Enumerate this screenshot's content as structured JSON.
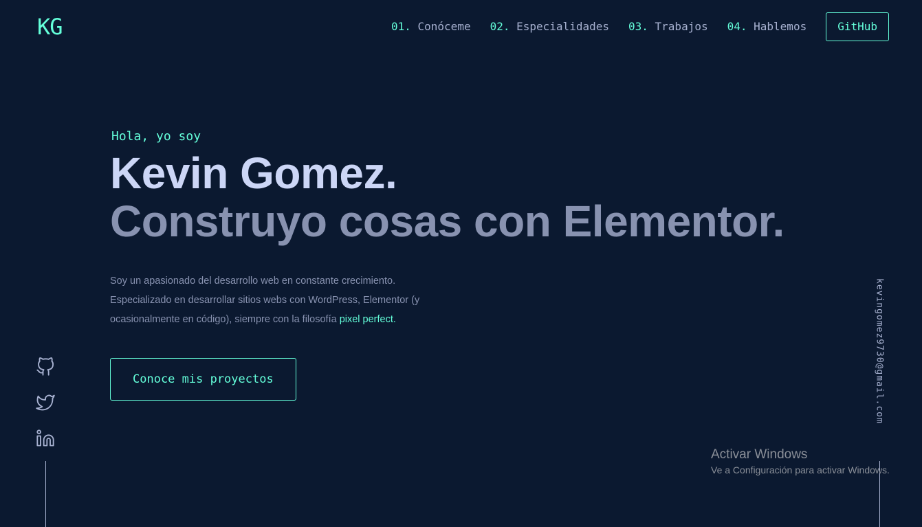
{
  "header": {
    "logo": "KG",
    "nav": [
      {
        "num": "01.",
        "label": "Conóceme"
      },
      {
        "num": "02.",
        "label": "Especialidades"
      },
      {
        "num": "03.",
        "label": "Trabajos"
      },
      {
        "num": "04.",
        "label": "Hablemos"
      }
    ],
    "github_label": "GitHub"
  },
  "hero": {
    "intro": "Hola, yo soy",
    "name": "Kevin Gomez.",
    "tagline": "Construyo cosas con Elementor.",
    "bio_line1": "Soy un apasionado del desarrollo web en constante crecimiento.",
    "bio_line2": "Especializado en desarrollar sitios webs con WordPress, Elementor (y",
    "bio_line3": "ocasionalmente en código), siempre con la filosofía",
    "bio_accent": "pixel perfect.",
    "cta_label": "Conoce mis proyectos"
  },
  "social": {
    "icons": [
      "github-icon",
      "twitter-icon",
      "linkedin-icon"
    ]
  },
  "email": "kevingomez9730@gmail.com",
  "windows_watermark": {
    "title": "Activar Windows",
    "subtitle": "Ve a Configuración para activar Windows."
  },
  "colors": {
    "background": "#0b1930",
    "accent": "#64ffda",
    "heading": "#ccd6f6",
    "text": "#8892b0"
  }
}
